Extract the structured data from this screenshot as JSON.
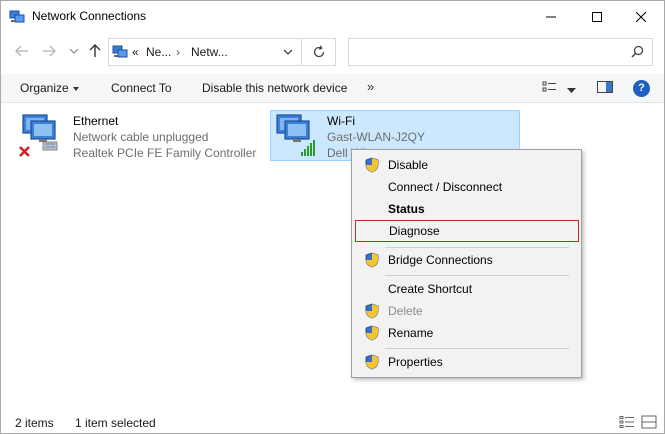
{
  "window": {
    "title": "Network Connections"
  },
  "nav": {
    "breadcrumbs": [
      "Ne...",
      "Netw..."
    ],
    "crumb_prefix": "«",
    "search_placeholder": ""
  },
  "toolbar": {
    "organize": "Organize",
    "connect_to": "Connect To",
    "disable_device": "Disable this network device",
    "more": "»"
  },
  "items": [
    {
      "name": "Ethernet",
      "status": "Network cable unplugged",
      "device": "Realtek PCIe FE Family Controller",
      "icon": "ethernet-adapter-icon"
    },
    {
      "name": "Wi-Fi",
      "status": "Gast-WLAN-J2QY",
      "device": "Dell Wireless 1705 802.11b|g|n (2.4...",
      "device_visible": "Dell Wi",
      "icon": "wifi-adapter-icon",
      "selected": true
    }
  ],
  "context_menu": {
    "items": [
      {
        "label": "Disable",
        "shield": true
      },
      {
        "label": "Connect / Disconnect",
        "shield": false
      },
      {
        "label": "Status",
        "shield": false,
        "bold": true
      },
      {
        "label": "Diagnose",
        "shield": false,
        "highlighted": true
      },
      {
        "label": "Bridge Connections",
        "shield": true
      },
      {
        "label": "Create Shortcut",
        "shield": false
      },
      {
        "label": "Delete",
        "shield": true,
        "disabled": true
      },
      {
        "label": "Rename",
        "shield": true
      },
      {
        "label": "Properties",
        "shield": true
      }
    ]
  },
  "status": {
    "item_count": "2 items",
    "selected": "1 item selected"
  },
  "colors": {
    "selection_bg": "#cce8ff",
    "selection_border": "#99d1ff",
    "highlight_border": "#c42b1c",
    "menu_bg": "#f2f2f2",
    "help_blue": "#1e5fbf"
  }
}
